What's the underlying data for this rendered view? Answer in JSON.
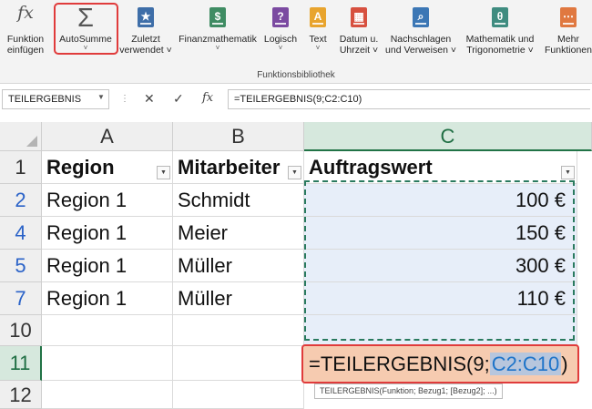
{
  "ribbon": {
    "buttons": [
      {
        "id": "funktion-einfuegen",
        "line1": "Funktion",
        "line2": "einfügen",
        "glyph": "fx",
        "color": "#555555"
      },
      {
        "id": "autosumme",
        "line1": "AutoSumme",
        "glyph": "Σ",
        "color": "#555555"
      },
      {
        "id": "zuletzt-verwendet",
        "line1": "Zuletzt",
        "line2": "verwendet ˅",
        "glyph": "★",
        "color": "#3e6ea8"
      },
      {
        "id": "finanzmathematik",
        "line1": "Finanzmathematik",
        "glyph": "$",
        "color": "#3f8c63"
      },
      {
        "id": "logisch",
        "line1": "Logisch",
        "glyph": "?",
        "color": "#7b4aa1"
      },
      {
        "id": "text",
        "line1": "Text",
        "glyph": "A",
        "color": "#e8a42e"
      },
      {
        "id": "datum-uhrzeit",
        "line1": "Datum u.",
        "line2": "Uhrzeit ˅",
        "glyph": "▦",
        "color": "#d7503f"
      },
      {
        "id": "nachschlagen-verweisen",
        "line1": "Nachschlagen",
        "line2": "und Verweisen ˅",
        "glyph": "⌕",
        "color": "#3c77b5"
      },
      {
        "id": "mathematik-trigonometrie",
        "line1": "Mathematik und",
        "line2": "Trigonometrie ˅",
        "glyph": "θ",
        "color": "#3f8c80"
      },
      {
        "id": "mehr-funktionen",
        "line1": "Mehr",
        "line2": "Funktionen",
        "glyph": "⋯",
        "color": "#e07840"
      }
    ],
    "group_label": "Funktionsbibliothek"
  },
  "formula_bar": {
    "name_box": "TEILERGEBNIS",
    "cancel_glyph": "✕",
    "confirm_glyph": "✓",
    "fx_glyph": "fx",
    "formula": "=TEILERGEBNIS(9;C2:C10)"
  },
  "grid": {
    "columns": [
      "A",
      "B",
      "C"
    ],
    "headers": [
      "Region",
      "Mitarbeiter",
      "Auftragswert"
    ],
    "rows": [
      {
        "row": "1"
      },
      {
        "row": "2",
        "a": "Region 1",
        "b": "Schmidt",
        "c": "100 €"
      },
      {
        "row": "4",
        "a": "Region 1",
        "b": "Meier",
        "c": "150 €"
      },
      {
        "row": "5",
        "a": "Region 1",
        "b": "Müller",
        "c": "300 €"
      },
      {
        "row": "7",
        "a": "Region 1",
        "b": "Müller",
        "c": "110 €"
      },
      {
        "row": "10"
      },
      {
        "row": "11"
      },
      {
        "row": "12"
      }
    ],
    "edit_prefix": "=TEILERGEBNIS(9;",
    "edit_ref": "C2:C10",
    "edit_suffix": ")",
    "tooltip": "TEILERGEBNIS(Funktion; Bezug1; [Bezug2]; ...)"
  },
  "colors": {
    "accent_green": "#217346",
    "highlight_red": "#e03b3b",
    "reference_blue": "#1e74c9"
  }
}
